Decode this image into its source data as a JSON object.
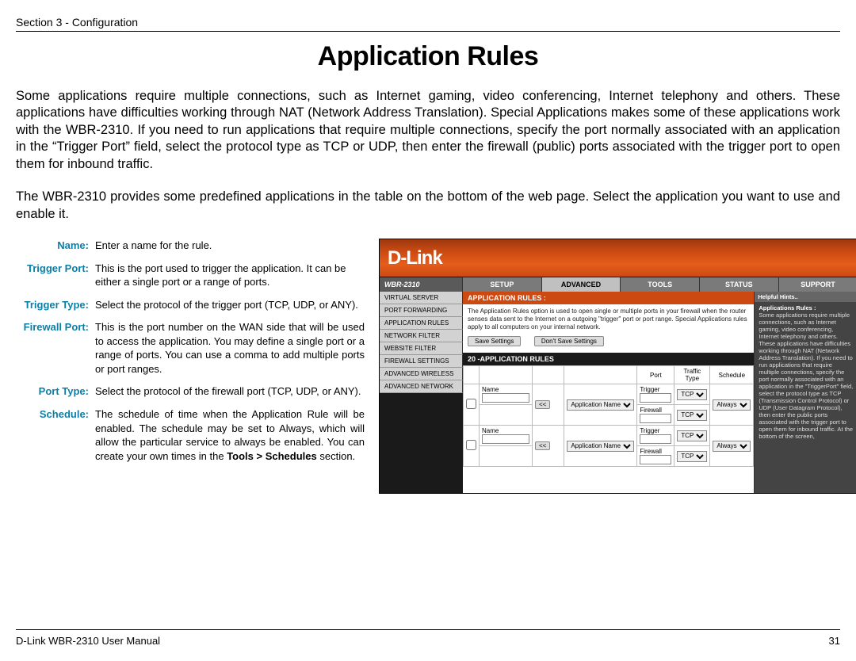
{
  "header": {
    "section": "Section 3 - Configuration"
  },
  "title": "Application Rules",
  "paragraphs": {
    "p1": "Some applications require multiple connections, such as Internet gaming, video conferencing, Internet telephony and others. These applications have difficulties working through NAT (Network Address Translation). Special Applications makes some of these applications work with the WBR-2310. If you need to run applications that require multiple connections, specify the port normally associated with an application in the “Trigger Port” field, select the protocol type as TCP or UDP, then enter the firewall (public) ports associated with the trigger port to open them for inbound traffic.",
    "p2": "The WBR-2310 provides some predefined applications in the table on the bottom of the web page. Select the application you want to use and enable it."
  },
  "defs": {
    "name_t": "Name:",
    "name_d": "Enter a name for the rule.",
    "trigport_t": "Trigger Port:",
    "trigport_d": "This is the port used to trigger the application. It can be either a single port or a range of ports.",
    "trigtype_t": "Trigger Type:",
    "trigtype_d": "Select the protocol of the trigger port (TCP, UDP, or ANY).",
    "fwport_t": "Firewall Port:",
    "fwport_d": "This is the port number on the WAN side that will be used to access the application. You may define a single port or a range of ports. You can use a comma to add multiple ports or port ranges.",
    "porttype_t": "Port Type:",
    "porttype_d": "Select the protocol of the firewall port (TCP, UDP, or ANY).",
    "sched_t": "Schedule:",
    "sched_d1": "The schedule of time when the Application Rule will be enabled. The schedule may be set to Always, which will allow the particular service to always be enabled. You can create your own times in the ",
    "sched_d_bold": "Tools > Schedules",
    "sched_d2": " section."
  },
  "router": {
    "brand": "D-Link",
    "model": "WBR-2310",
    "tabs": {
      "setup": "SETUP",
      "advanced": "ADVANCED",
      "tools": "TOOLS",
      "status": "STATUS",
      "support": "SUPPORT"
    },
    "side": [
      "VIRTUAL SERVER",
      "PORT FORWARDING",
      "APPLICATION RULES",
      "NETWORK FILTER",
      "WEBSITE FILTER",
      "FIREWALL SETTINGS",
      "ADVANCED WIRELESS",
      "ADVANCED NETWORK"
    ],
    "main": {
      "title": "APPLICATION RULES :",
      "desc": "The Application Rules option is used to open single or multiple ports in your firewall when the router senses data sent to the Internet on a outgoing \"trigger\" port or port range. Special Applications rules apply to all computers on your internal network.",
      "save": "Save Settings",
      "dont": "Don't Save Settings",
      "section": "20  -APPLICATION RULES",
      "th_port": "Port",
      "th_traffic": "Traffic Type",
      "th_schedule": "Schedule",
      "row_trigger": "Trigger",
      "row_firewall": "Firewall",
      "row_name": "Name",
      "app_selector": "Application Name",
      "tcp": "TCP",
      "always": "Always",
      "lt": "<<"
    },
    "help": {
      "title": "Helpful Hints..",
      "strong": "Applications Rules :",
      "body": "Some applications require multiple connections, such as Internet gaming, video conferencing, Internet telephony and others. These applications have difficulties working through NAT (Network Address Translation). If you need to run applications that require multiple connections, specify the port normally associated with an application in the \"TriggerPort\" field, select the protocol type as TCP (Transmission Control Protocol) or UDP (User Datagram Protocol), then enter the public ports associated with the trigger port to open them for inbound traffic. At the bottom of the screen,"
    }
  },
  "footer": {
    "left": "D-Link WBR-2310 User Manual",
    "right": "31"
  }
}
